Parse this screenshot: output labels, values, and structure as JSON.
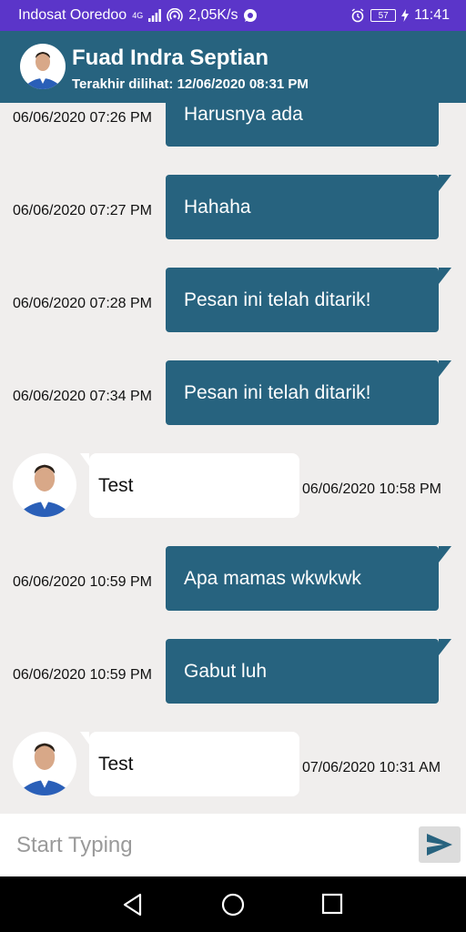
{
  "status_bar": {
    "carrier": "Indosat Ooredoo",
    "network_type": "4G",
    "speed": "2,05K/s",
    "battery": "57",
    "time": "11:41",
    "icons": [
      "signal-icon",
      "hotspot-icon",
      "whatsapp-icon",
      "alarm-icon",
      "battery-icon",
      "charging-icon"
    ]
  },
  "header": {
    "contact_name": "Fuad Indra Septian",
    "last_seen": "Terakhir dilihat: 12/06/2020 08:31 PM"
  },
  "messages": [
    {
      "direction": "out",
      "text": "Harusnya ada",
      "time": "06/06/2020 07:26 PM"
    },
    {
      "direction": "out",
      "text": "Hahaha",
      "time": "06/06/2020 07:27 PM"
    },
    {
      "direction": "out",
      "text": "Pesan ini telah ditarik!",
      "time": "06/06/2020 07:28 PM"
    },
    {
      "direction": "out",
      "text": "Pesan ini telah ditarik!",
      "time": "06/06/2020 07:34 PM"
    },
    {
      "direction": "in",
      "text": "Test",
      "time": "06/06/2020 10:58 PM"
    },
    {
      "direction": "out",
      "text": "Apa mamas wkwkwk",
      "time": "06/06/2020 10:59 PM"
    },
    {
      "direction": "out",
      "text": "Gabut luh",
      "time": "06/06/2020 10:59 PM"
    },
    {
      "direction": "in",
      "text": "Test",
      "time": "07/06/2020 10:31 AM"
    }
  ],
  "composer": {
    "placeholder": "Start Typing",
    "value": ""
  },
  "colors": {
    "status_bar": "#5b35c9",
    "primary": "#27637f",
    "chat_background": "#f0eeed",
    "incoming_bubble": "#ffffff"
  },
  "nav_bar": {
    "icons": [
      "back-icon",
      "home-icon",
      "recents-icon"
    ]
  }
}
